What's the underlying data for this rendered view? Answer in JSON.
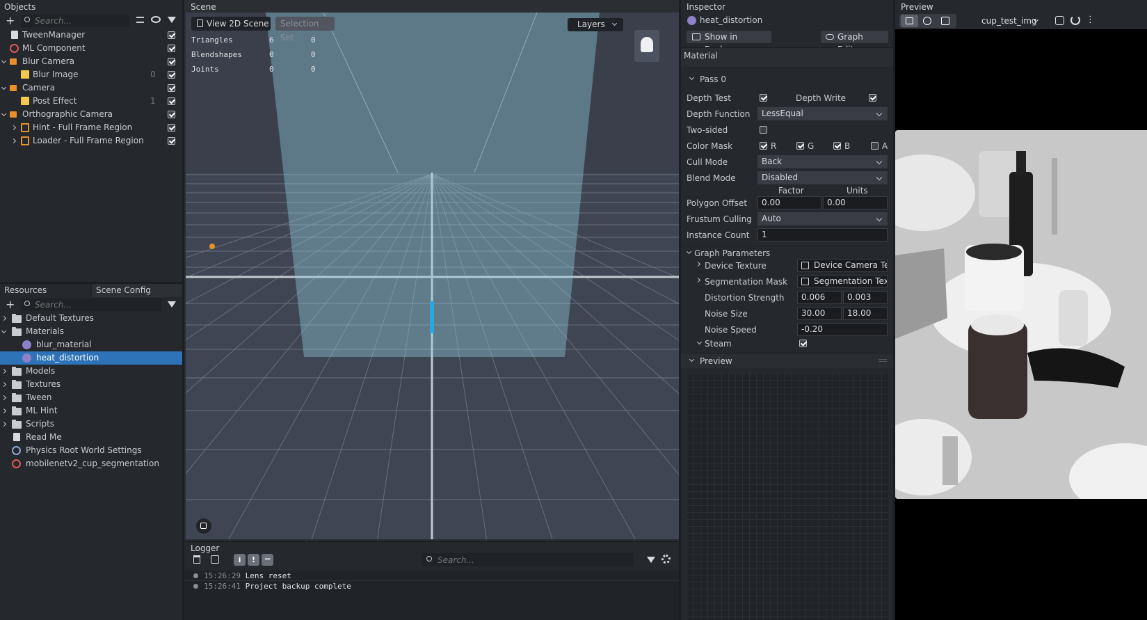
{
  "objects": {
    "title": "Objects",
    "search_placeholder": "Search...",
    "items": [
      {
        "label": "TweenManager",
        "count": ""
      },
      {
        "label": "ML Component",
        "count": ""
      },
      {
        "label": "Blur Camera",
        "count": ""
      },
      {
        "label": "Blur Image",
        "count": "0"
      },
      {
        "label": "Camera",
        "count": ""
      },
      {
        "label": "Post Effect",
        "count": "1"
      },
      {
        "label": "Orthographic Camera",
        "count": ""
      },
      {
        "label": "Hint - Full Frame Region",
        "count": ""
      },
      {
        "label": "Loader - Full Frame Region",
        "count": ""
      }
    ]
  },
  "resources": {
    "tab_resources": "Resources",
    "tab_scene_config": "Scene Config",
    "search_placeholder": "Search...",
    "items": [
      {
        "label": "Default Textures"
      },
      {
        "label": "Materials"
      },
      {
        "label": "blur_material"
      },
      {
        "label": "heat_distortion"
      },
      {
        "label": "Models"
      },
      {
        "label": "Textures"
      },
      {
        "label": "Tween"
      },
      {
        "label": "ML Hint"
      },
      {
        "label": "Scripts"
      },
      {
        "label": "Read Me"
      },
      {
        "label": "Physics Root World Settings"
      },
      {
        "label": "mobilenetv2_cup_segmentation"
      }
    ]
  },
  "scene": {
    "title": "Scene",
    "view_2d_label": "View 2D Scene",
    "selection_set_label": "Selection Set",
    "layers_label": "Layers",
    "stats": [
      {
        "label": "Triangles",
        "a": "6",
        "b": "0"
      },
      {
        "label": "Blendshapes",
        "a": "0",
        "b": "0"
      },
      {
        "label": "Joints",
        "a": "0",
        "b": "0"
      }
    ]
  },
  "logger": {
    "title": "Logger",
    "search_placeholder": "Search...",
    "entries": [
      {
        "time": "15:26:29",
        "message": "Lens reset"
      },
      {
        "time": "15:26:41",
        "message": "Project backup complete"
      }
    ]
  },
  "inspector": {
    "title": "Inspector",
    "asset_name": "heat_distortion",
    "show_in_explorer": "Show in Explorer",
    "graph_editor": "Graph Editor",
    "section_material": "Material",
    "pass": "Pass 0",
    "depth_test": "Depth Test",
    "depth_write": "Depth Write",
    "depth_function": "Depth Function",
    "depth_function_value": "LessEqual",
    "two_sided": "Two-sided",
    "color_mask": "Color Mask",
    "mask_r": "R",
    "mask_g": "G",
    "mask_b": "B",
    "mask_a": "A",
    "cull_mode": "Cull Mode",
    "cull_mode_value": "Back",
    "blend_mode": "Blend Mode",
    "blend_mode_value": "Disabled",
    "factor": "Factor",
    "units": "Units",
    "polygon_offset": "Polygon Offset",
    "polygon_factor": "0.00",
    "polygon_units": "0.00",
    "frustum_culling": "Frustum Culling",
    "frustum_culling_value": "Auto",
    "instance_count": "Instance Count",
    "instance_count_value": "1",
    "graph_parameters": "Graph Parameters",
    "device_texture": "Device Texture",
    "device_texture_value": "Device Camera Text",
    "segmentation_mask": "Segmentation Mask",
    "segmentation_mask_value": "Segmentation Text",
    "distortion_strength": "Distortion Strength",
    "distortion_x": "0.006",
    "distortion_y": "0.003",
    "noise_size": "Noise Size",
    "noise_size_x": "30.00",
    "noise_size_y": "18.00",
    "noise_speed": "Noise Speed",
    "noise_speed_value": "-0.20",
    "steam": "Steam",
    "preview_section": "Preview"
  },
  "preview": {
    "title": "Preview",
    "source_label": "cup_test_img"
  }
}
